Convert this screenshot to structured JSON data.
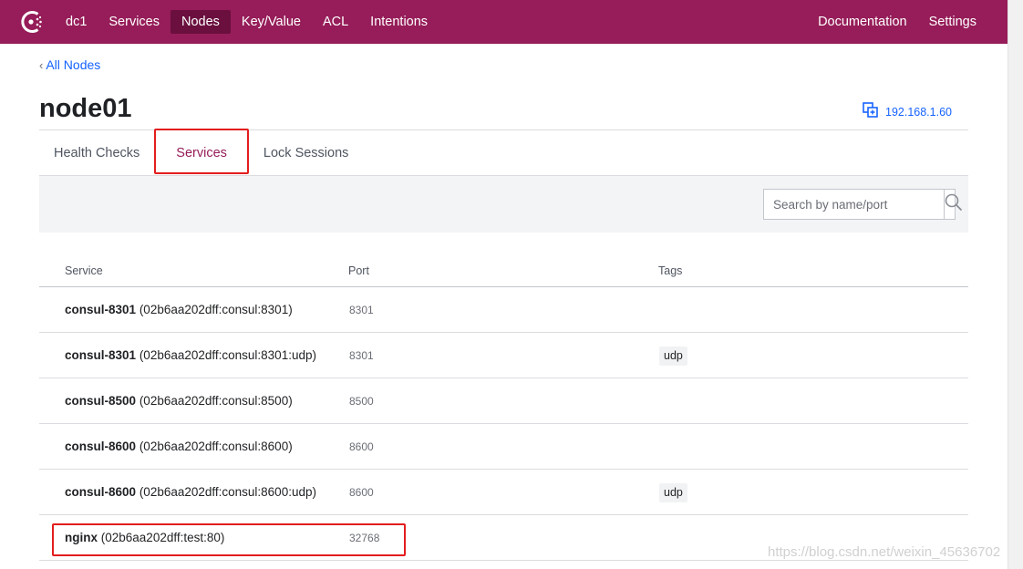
{
  "nav": {
    "datacenter": "dc1",
    "items": [
      {
        "label": "Services",
        "active": false
      },
      {
        "label": "Nodes",
        "active": true
      },
      {
        "label": "Key/Value",
        "active": false
      },
      {
        "label": "ACL",
        "active": false
      },
      {
        "label": "Intentions",
        "active": false
      }
    ],
    "right_items": [
      {
        "label": "Documentation"
      },
      {
        "label": "Settings"
      }
    ],
    "brand_color": "#961d59",
    "active_color": "#6a0f3e"
  },
  "breadcrumb": {
    "label": "All Nodes"
  },
  "page": {
    "title": "node01",
    "address": "192.168.1.60"
  },
  "tabs": [
    {
      "label": "Health Checks",
      "active": false
    },
    {
      "label": "Services",
      "active": true
    },
    {
      "label": "Lock Sessions",
      "active": false
    }
  ],
  "search": {
    "placeholder": "Search by name/port",
    "value": ""
  },
  "table": {
    "headers": {
      "service": "Service",
      "port": "Port",
      "tags": "Tags"
    },
    "rows": [
      {
        "name": "consul-8301",
        "id": "(02b6aa202dff:consul:8301)",
        "port": "8301",
        "tag": ""
      },
      {
        "name": "consul-8301",
        "id": "(02b6aa202dff:consul:8301:udp)",
        "port": "8301",
        "tag": "udp"
      },
      {
        "name": "consul-8500",
        "id": "(02b6aa202dff:consul:8500)",
        "port": "8500",
        "tag": ""
      },
      {
        "name": "consul-8600",
        "id": "(02b6aa202dff:consul:8600)",
        "port": "8600",
        "tag": ""
      },
      {
        "name": "consul-8600",
        "id": "(02b6aa202dff:consul:8600:udp)",
        "port": "8600",
        "tag": "udp"
      },
      {
        "name": "nginx",
        "id": "(02b6aa202dff:test:80)",
        "port": "32768",
        "tag": ""
      }
    ]
  },
  "watermark": "https://blog.csdn.net/weixin_45636702"
}
